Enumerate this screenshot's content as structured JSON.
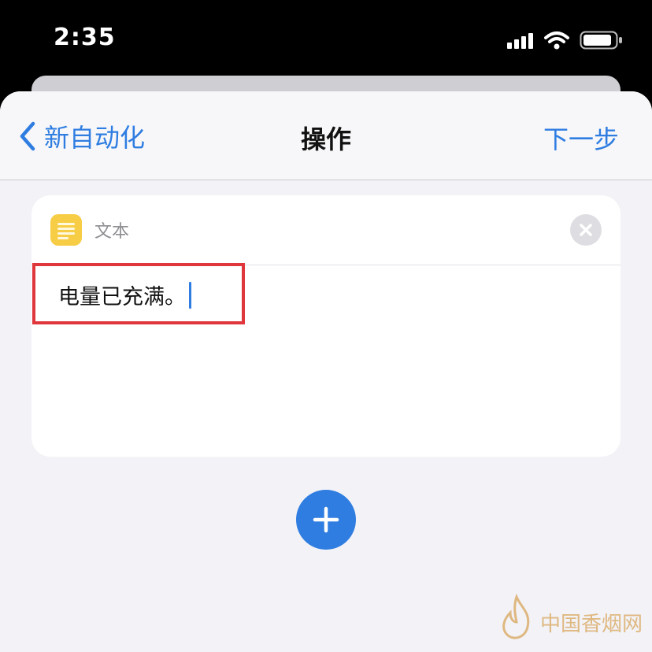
{
  "status_bar": {
    "time": "2:35"
  },
  "nav": {
    "back_label": "新自动化",
    "title": "操作",
    "next_label": "下一步"
  },
  "action_card": {
    "label": "文本",
    "text_value": "电量已充满。"
  },
  "watermark": {
    "text": "中国香烟网"
  },
  "icons": {
    "signal": "cellular-signal-icon",
    "wifi": "wifi-icon",
    "battery": "battery-icon",
    "back": "chevron-left-icon",
    "action": "text-action-icon",
    "close": "close-icon",
    "add": "plus-icon"
  },
  "colors": {
    "accent": "#2f7de1",
    "action_icon": "#f7cd45",
    "highlight": "#e0373d"
  }
}
